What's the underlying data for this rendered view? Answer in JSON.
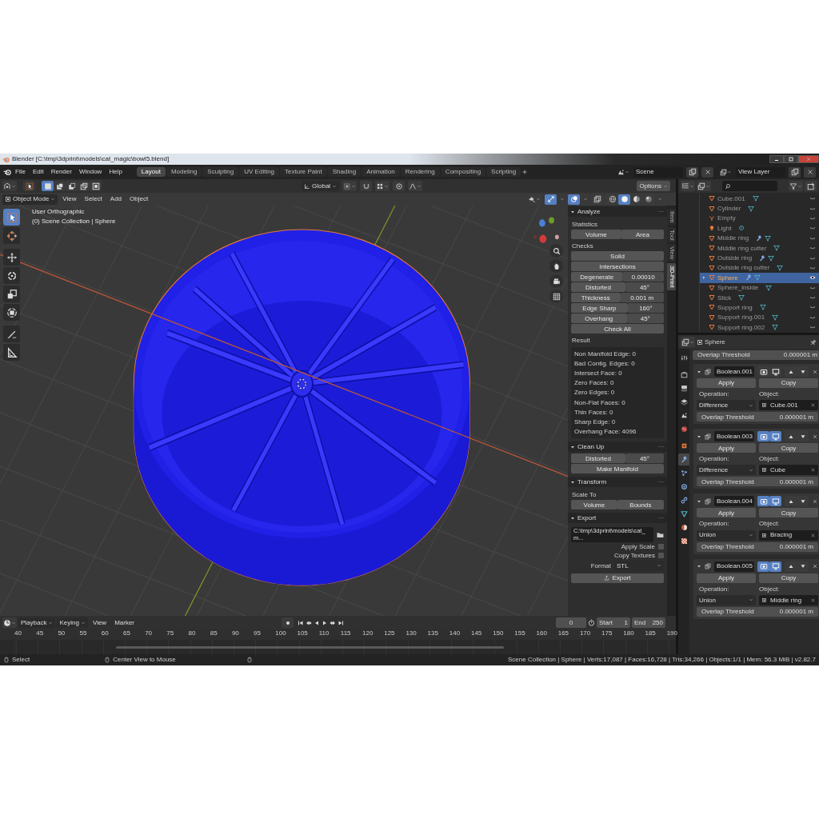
{
  "window": {
    "title": "Blender [C:\\tmp\\3dprint\\models\\cat_magic\\bowl5.blend]"
  },
  "menu": [
    "File",
    "Edit",
    "Render",
    "Window",
    "Help"
  ],
  "workspaces": [
    {
      "label": "Layout",
      "selected": true
    },
    {
      "label": "Modeling",
      "selected": false
    },
    {
      "label": "Sculpting",
      "selected": false
    },
    {
      "label": "UV Editing",
      "selected": false
    },
    {
      "label": "Texture Paint",
      "selected": false
    },
    {
      "label": "Shading",
      "selected": false
    },
    {
      "label": "Animation",
      "selected": false
    },
    {
      "label": "Rendering",
      "selected": false
    },
    {
      "label": "Compositing",
      "selected": false
    },
    {
      "label": "Scripting",
      "selected": false
    }
  ],
  "scene": "Scene",
  "view_layer": "View Layer",
  "viewport": {
    "selection_modes": [
      {
        "kind": "set",
        "selected": true
      },
      {
        "kind": "extend",
        "selected": false
      },
      {
        "kind": "subtract",
        "selected": false
      },
      {
        "kind": "difference",
        "selected": false
      },
      {
        "kind": "intersect",
        "selected": false
      }
    ],
    "orientation": "Global",
    "options": "Options",
    "mode": "Object Mode",
    "menus": [
      "View",
      "Select",
      "Add",
      "Object"
    ],
    "gizmos": {
      "on": true
    },
    "overlays": {
      "on": true
    },
    "xray": {
      "on": false
    },
    "shading_modes": [
      {
        "kind": "wireframe",
        "selected": false
      },
      {
        "kind": "solid",
        "selected": true
      },
      {
        "kind": "material",
        "selected": false
      },
      {
        "kind": "rendered",
        "selected": false
      }
    ],
    "view_name": "User Orthographic",
    "collection_line": "(0) Scene Collection | Sphere",
    "tools": [
      {
        "kind": "select",
        "selected": true
      },
      {
        "kind": "cursor",
        "selected": false
      },
      {
        "kind": "move",
        "selected": false
      },
      {
        "kind": "rotate",
        "selected": false
      },
      {
        "kind": "scale",
        "selected": false
      },
      {
        "kind": "transform",
        "selected": false
      },
      {
        "kind": "annotate",
        "selected": false
      },
      {
        "kind": "measure",
        "selected": false
      }
    ]
  },
  "sidebar": {
    "tabs": [
      {
        "label": "Item",
        "selected": false
      },
      {
        "label": "Tool",
        "selected": false
      },
      {
        "label": "View",
        "selected": false
      },
      {
        "label": "3D-Print",
        "selected": true
      }
    ],
    "panels": [
      {
        "title": "Analyze",
        "expanded": true,
        "rows": [
          {
            "kind": "label",
            "text": "Statistics"
          },
          {
            "kind": "buttons",
            "labels": [
              "Volume",
              "Area"
            ]
          },
          {
            "kind": "label",
            "text": "Checks"
          },
          {
            "kind": "button",
            "text": "Solid"
          },
          {
            "kind": "button",
            "text": "Intersections"
          },
          {
            "kind": "prop",
            "label": "Degenerate",
            "value": "0.00010"
          },
          {
            "kind": "prop",
            "label": "Distorted",
            "value": "45°"
          },
          {
            "kind": "prop",
            "label": "Thickness",
            "value": "0.001 m"
          },
          {
            "kind": "prop",
            "label": "Edge Sharp",
            "value": "160°"
          },
          {
            "kind": "prop",
            "label": "Overhang",
            "value": "45°"
          },
          {
            "kind": "button",
            "text": "Check All"
          },
          {
            "kind": "label",
            "text": "Result"
          },
          {
            "kind": "results",
            "lines": [
              "Non Manifold Edge: 0",
              "Bad Contig. Edges: 0",
              "Intersect Face: 0",
              "Zero Faces: 0",
              "Zero Edges: 0",
              "Non-Flat Faces: 0",
              "Thin Faces: 0",
              "Sharp Edge: 0",
              "Overhang Face: 4096"
            ]
          }
        ]
      },
      {
        "title": "Clean Up",
        "expanded": true,
        "rows": [
          {
            "kind": "prop",
            "label": "Distorted",
            "value": "45°"
          },
          {
            "kind": "button",
            "text": "Make Manifold"
          }
        ]
      },
      {
        "title": "Transform",
        "expanded": true,
        "rows": [
          {
            "kind": "label",
            "text": "Scale To"
          },
          {
            "kind": "buttons",
            "labels": [
              "Volume",
              "Bounds"
            ]
          }
        ]
      },
      {
        "title": "Export",
        "expanded": true,
        "rows": [
          {
            "kind": "path",
            "value": "C:\\tmp\\3dprint\\models\\cat_m..."
          },
          {
            "kind": "checkbox",
            "label": "Apply Scale",
            "checked": false
          },
          {
            "kind": "checkbox",
            "label": "Copy Textures",
            "checked": false
          },
          {
            "kind": "select",
            "label": "Format",
            "value": "STL"
          },
          {
            "kind": "export",
            "text": "Export"
          }
        ]
      }
    ]
  },
  "outliner": {
    "items": [
      {
        "name": "Cube.001",
        "kind": "mesh",
        "modifier": false,
        "expandable": false,
        "visible": false,
        "selected": false
      },
      {
        "name": "Cylinder",
        "kind": "mesh",
        "modifier": false,
        "expandable": false,
        "visible": false,
        "selected": false
      },
      {
        "name": "Empty",
        "kind": "empty",
        "modifier": false,
        "expandable": false,
        "visible": false,
        "selected": false
      },
      {
        "name": "Light",
        "kind": "light",
        "modifier": false,
        "expandable": false,
        "visible": false,
        "selected": false
      },
      {
        "name": "Middle ring",
        "kind": "mesh",
        "modifier": true,
        "expandable": false,
        "visible": false,
        "selected": false
      },
      {
        "name": "Middle ring cutter",
        "kind": "mesh",
        "modifier": false,
        "expandable": false,
        "visible": false,
        "selected": false
      },
      {
        "name": "Outside ring",
        "kind": "mesh",
        "modifier": true,
        "expandable": false,
        "visible": false,
        "selected": false
      },
      {
        "name": "Outside ring cutter",
        "kind": "mesh",
        "modifier": false,
        "expandable": false,
        "visible": false,
        "selected": false
      },
      {
        "name": "Sphere",
        "kind": "mesh",
        "modifier": true,
        "expandable": true,
        "visible": true,
        "selected": true
      },
      {
        "name": "Sphere_inside",
        "kind": "mesh",
        "modifier": false,
        "expandable": false,
        "visible": false,
        "selected": false
      },
      {
        "name": "Stick",
        "kind": "mesh",
        "modifier": false,
        "expandable": false,
        "visible": false,
        "selected": false
      },
      {
        "name": "Support ring",
        "kind": "mesh",
        "modifier": false,
        "expandable": false,
        "visible": false,
        "selected": false
      },
      {
        "name": "Support ring.001",
        "kind": "mesh",
        "modifier": false,
        "expandable": false,
        "visible": false,
        "selected": false
      },
      {
        "name": "Support ring.002",
        "kind": "mesh",
        "modifier": false,
        "expandable": false,
        "visible": false,
        "selected": false
      }
    ]
  },
  "properties": {
    "tabs": [
      {
        "kind": "tool",
        "selected": false
      },
      {
        "kind": "render",
        "selected": false
      },
      {
        "kind": "output",
        "selected": false
      },
      {
        "kind": "view_layer",
        "selected": false
      },
      {
        "kind": "scene",
        "selected": false
      },
      {
        "kind": "world",
        "selected": false
      },
      {
        "kind": "object",
        "selected": false
      },
      {
        "kind": "modifier",
        "selected": true
      },
      {
        "kind": "particles",
        "selected": false
      },
      {
        "kind": "physics",
        "selected": false
      },
      {
        "kind": "constraints",
        "selected": false
      },
      {
        "kind": "data",
        "selected": false
      },
      {
        "kind": "material",
        "selected": false
      },
      {
        "kind": "texture",
        "selected": false
      }
    ],
    "object": "Sphere",
    "top_threshold": {
      "label": "Overlap Threshold",
      "value": "0.000001 m"
    },
    "modifiers": [
      {
        "name": "Boolean.001",
        "show_render": false,
        "show_viewport": false,
        "apply": "Apply",
        "copy": "Copy",
        "operation_label": "Operation:",
        "object_label": "Object:",
        "operation": "Difference",
        "object": "Cube.001",
        "threshold_label": "Overlap Threshold",
        "threshold": "0.000001 m"
      },
      {
        "name": "Boolean.003",
        "show_render": true,
        "show_viewport": true,
        "apply": "Apply",
        "copy": "Copy",
        "operation_label": "Operation:",
        "object_label": "Object:",
        "operation": "Difference",
        "object": "Cube",
        "threshold_label": "Overlap Threshold",
        "threshold": "0.000001 m"
      },
      {
        "name": "Boolean.004",
        "show_render": true,
        "show_viewport": true,
        "apply": "Apply",
        "copy": "Copy",
        "operation_label": "Operation:",
        "object_label": "Object:",
        "operation": "Union",
        "object": "Bracing",
        "threshold_label": "Overlap Threshold",
        "threshold": "0.000001 m"
      },
      {
        "name": "Boolean.005",
        "show_render": true,
        "show_viewport": true,
        "apply": "Apply",
        "copy": "Copy",
        "operation_label": "Operation:",
        "object_label": "Object:",
        "operation": "Union",
        "object": "Middle ring",
        "threshold_label": "Overlap Threshold",
        "threshold": "0.000001 m"
      }
    ]
  },
  "timeline": {
    "menus": [
      {
        "label": "Playback",
        "kind": "dropdown"
      },
      {
        "label": "Keying",
        "kind": "dropdown"
      },
      {
        "label": "View",
        "kind": "menu"
      },
      {
        "label": "Marker",
        "kind": "menu"
      }
    ],
    "current_frame": "0",
    "start_label": "Start",
    "start": "1",
    "end_label": "End",
    "end": "250",
    "ticks": [
      "40",
      "45",
      "50",
      "55",
      "60",
      "65",
      "70",
      "75",
      "80",
      "85",
      "90",
      "95",
      "100",
      "105",
      "110",
      "115",
      "120",
      "125",
      "130",
      "135",
      "140",
      "145",
      "150",
      "155",
      "160",
      "165",
      "170",
      "175",
      "180",
      "185",
      "190"
    ]
  },
  "status_bar": {
    "hints": [
      "Select",
      "Center View to Mouse"
    ],
    "stats": "Scene Collection | Sphere | Verts:17,087 | Faces:16,728 | Tris:34,266 | Objects:1/1 | Mem: 56.3 MiB | v2.82.7"
  }
}
